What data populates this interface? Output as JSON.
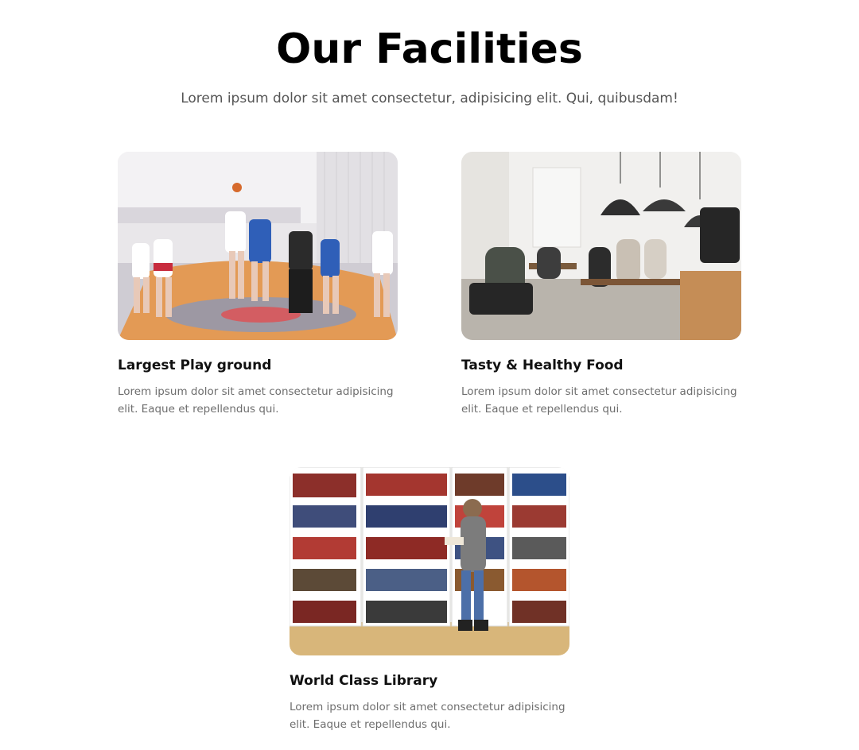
{
  "header": {
    "title": "Our Facilities",
    "subtitle": "Lorem ipsum dolor sit amet consectetur, adipisicing elit. Qui, quibusdam!"
  },
  "facilities": [
    {
      "title": "Largest Play ground",
      "description": "Lorem ipsum dolor sit amet consectetur adipisicing elit. Eaque et repellendus qui.",
      "image": "basketball-game-photo"
    },
    {
      "title": "Tasty & Healthy Food",
      "description": "Lorem ipsum dolor sit amet consectetur adipisicing elit. Eaque et repellendus qui.",
      "image": "cafe-dining-photo"
    },
    {
      "title": "World Class Library",
      "description": "Lorem ipsum dolor sit amet consectetur adipisicing elit. Eaque et repellendus qui.",
      "image": "library-bookshelves-photo"
    }
  ]
}
